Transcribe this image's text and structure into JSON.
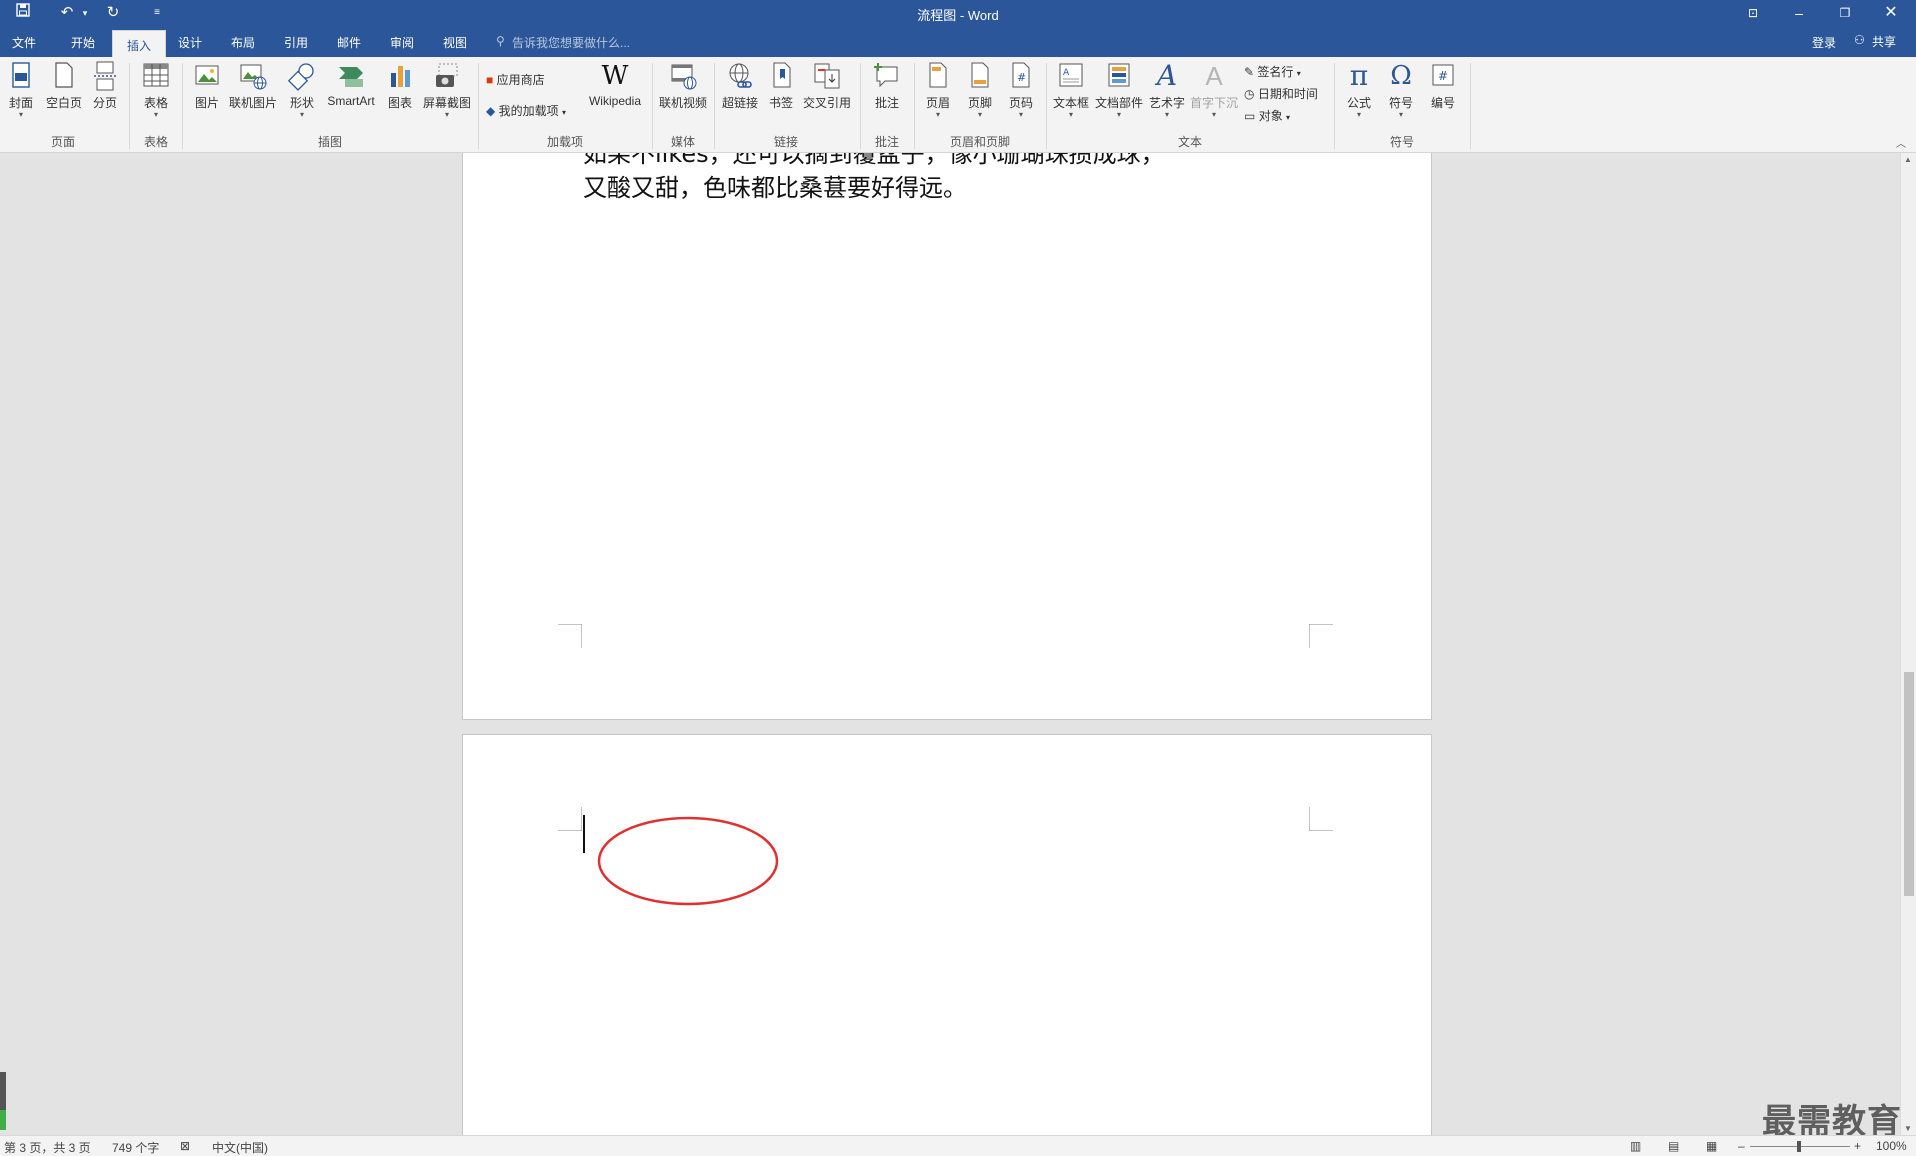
{
  "app": {
    "window_title": "流程图 - Word"
  },
  "tabs": [
    "文件",
    "开始",
    "插入",
    "设计",
    "布局",
    "引用",
    "邮件",
    "审阅",
    "视图"
  ],
  "tell_me": "告诉我您想要做什么...",
  "account": {
    "login": "登录",
    "share": "共享"
  },
  "ribbon": {
    "groups": {
      "pages": "页面",
      "tables": "表格",
      "illustrations": "插图",
      "addins": "加载项",
      "media": "媒体",
      "links": "链接",
      "comments": "批注",
      "header_footer": "页眉和页脚",
      "text": "文本",
      "symbols": "符号"
    },
    "buttons": {
      "cover": "封面",
      "blank_page": "空白页",
      "page_break": "分页",
      "table": "表格",
      "picture": "图片",
      "online_picture": "联机图片",
      "shapes": "形状",
      "smartart": "SmartArt",
      "chart": "图表",
      "screenshot": "屏幕截图",
      "store": "应用商店",
      "my_addins": "我的加载项",
      "wikipedia": "Wikipedia",
      "online_video": "联机视频",
      "hyperlink": "超链接",
      "bookmark": "书签",
      "cross_ref": "交叉引用",
      "comment": "批注",
      "header": "页眉",
      "footer": "页脚",
      "page_number": "页码",
      "textbox": "文本框",
      "quick_parts": "文档部件",
      "wordart": "艺术字",
      "dropcap": "首字下沉",
      "signature": "签名行",
      "datetime": "日期和时间",
      "object": "对象",
      "equation": "公式",
      "symbol": "符号",
      "number": "编号"
    }
  },
  "document": {
    "page1_line1": "如果不likes，还可以摘到覆盆子，像小珊瑚珠攒成球，",
    "page1_line2": "又酸又甜，色味都比桑葚要好得远。"
  },
  "status": {
    "page": "第 3 页，共 3 页",
    "words": "749 个字",
    "language": "中文(中国)",
    "zoom": "100%"
  },
  "watermark": "最需教育"
}
